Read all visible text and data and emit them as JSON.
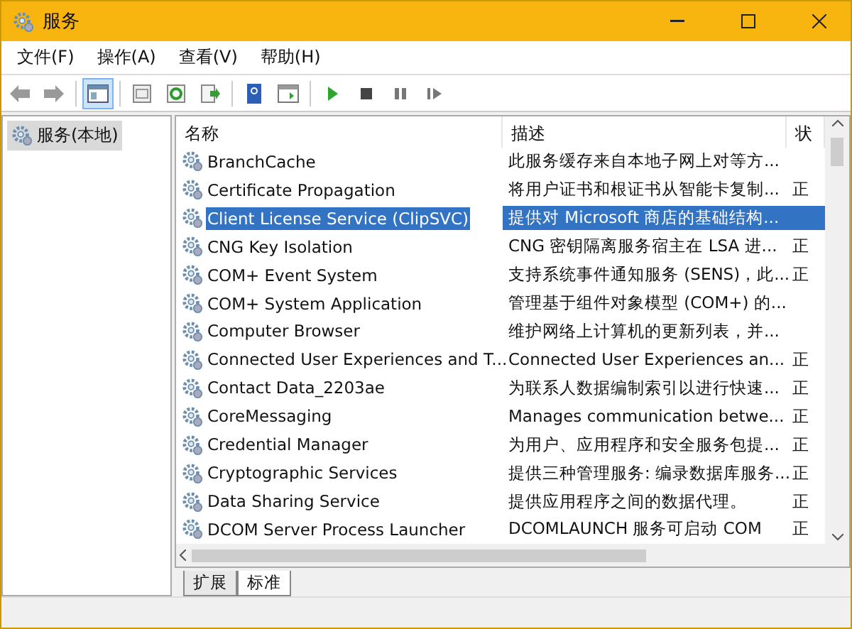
{
  "window": {
    "title": "服务"
  },
  "menu": [
    "文件(F)",
    "操作(A)",
    "查看(V)",
    "帮助(H)"
  ],
  "toolbar_groups": [
    {
      "buttons": [
        {
          "kind": "back",
          "on": false
        },
        {
          "kind": "forward",
          "on": false
        }
      ]
    },
    {
      "buttons": [
        {
          "kind": "pane",
          "on": true
        }
      ]
    },
    {
      "buttons": [
        {
          "kind": "props",
          "on": false
        },
        {
          "kind": "refresh",
          "on": false
        },
        {
          "kind": "export",
          "on": false
        }
      ]
    },
    {
      "buttons": [
        {
          "kind": "help",
          "on": false
        },
        {
          "kind": "console",
          "on": false
        }
      ]
    },
    {
      "buttons": [
        {
          "kind": "play",
          "on": false
        },
        {
          "kind": "stop",
          "on": false
        },
        {
          "kind": "pause",
          "on": false
        },
        {
          "kind": "restart",
          "on": false
        }
      ]
    }
  ],
  "tree": [
    {
      "label": "服务(本地)",
      "selected": true
    }
  ],
  "table": {
    "columns": [
      "名称",
      "描述",
      "状"
    ],
    "rows": [
      {
        "name": "BranchCache",
        "description": "此服务缓存来自本地子网上对等方...",
        "selected": false
      },
      {
        "name": "Certificate Propagation",
        "description": "将用户证书和根证书从智能卡复制...",
        "status": "正",
        "selected": false
      },
      {
        "name": "Client License Service (ClipSVC)",
        "description": "提供对 Microsoft 商店的基础结构...",
        "selected": true
      },
      {
        "name": "CNG Key Isolation",
        "description": "CNG 密钥隔离服务宿主在 LSA 进...",
        "status": "正",
        "selected": false
      },
      {
        "name": "COM+ Event System",
        "description": "支持系统事件通知服务 (SENS)，此...",
        "status": "正",
        "selected": false
      },
      {
        "name": "COM+ System Application",
        "description": "管理基于组件对象模型 (COM+) 的...",
        "selected": false
      },
      {
        "name": "Computer Browser",
        "description": "维护网络上计算机的更新列表，并...",
        "selected": false
      },
      {
        "name": "Connected User Experiences and T...",
        "description": "Connected User Experiences an...",
        "status": "正",
        "selected": false
      },
      {
        "name": "Contact Data_2203ae",
        "description": "为联系人数据编制索引以进行快速...",
        "status": "正",
        "selected": false
      },
      {
        "name": "CoreMessaging",
        "description": "Manages communication betwe...",
        "status": "正",
        "selected": false
      },
      {
        "name": "Credential Manager",
        "description": "为用户、应用程序和安全服务包提...",
        "status": "正",
        "selected": false
      },
      {
        "name": "Cryptographic Services",
        "description": "提供三种管理服务: 编录数据库服务...",
        "status": "正",
        "selected": false
      },
      {
        "name": "Data Sharing Service",
        "description": "提供应用程序之间的数据代理。",
        "status": "正",
        "selected": false
      },
      {
        "name": "DCOM Server Process Launcher",
        "description": "DCOMLAUNCH 服务可启动 COM",
        "status": "正",
        "selected": false
      }
    ]
  },
  "bottom_tabs": [
    {
      "label": "扩展",
      "selected": false
    },
    {
      "label": "标准",
      "selected": true
    }
  ]
}
